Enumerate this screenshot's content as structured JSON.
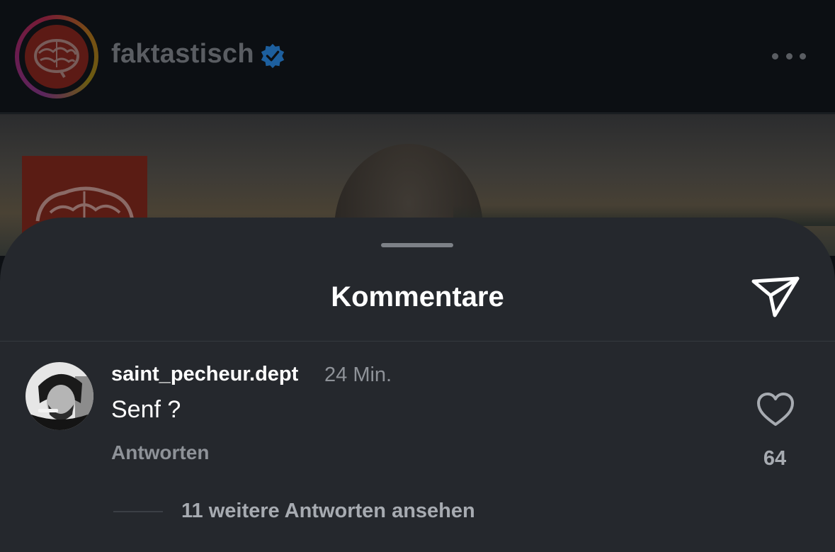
{
  "post": {
    "account_name": "faktastisch",
    "verified_icon": "verified-badge-icon",
    "more_icon": "more-horizontal-icon"
  },
  "comments_sheet": {
    "title": "Kommentare",
    "share_icon": "send-icon"
  },
  "comment": {
    "username": "saint_pecheur.dept",
    "time": "24 Min.",
    "text": "Senf ?",
    "reply_label": "Antworten",
    "like_icon": "heart-icon",
    "like_count": "64",
    "view_replies_label": "11 weitere Antworten ansehen"
  },
  "colors": {
    "sheet_background": "#25282d",
    "verified_blue": "#1d5f9e",
    "secondary_text": "#8e9298"
  }
}
